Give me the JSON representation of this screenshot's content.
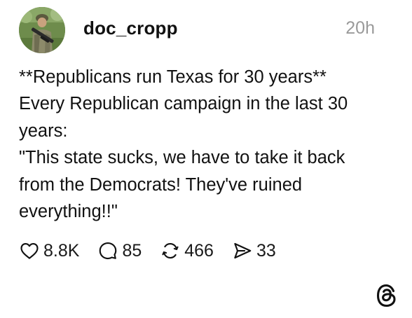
{
  "post": {
    "author": {
      "username": "doc_cropp",
      "avatar_icon": "soldier-avatar"
    },
    "timestamp": "20h",
    "text_lines": [
      "**Republicans run Texas for 30 years**",
      "Every Republican campaign in the last 30",
      "years:",
      "\"This state sucks, we have to take it back",
      "from the Democrats! They've ruined",
      "everything!!\""
    ],
    "actions": {
      "like": {
        "icon": "heart-icon",
        "count": "8.8K"
      },
      "reply": {
        "icon": "comment-icon",
        "count": "85"
      },
      "repost": {
        "icon": "repost-icon",
        "count": "466"
      },
      "share": {
        "icon": "send-icon",
        "count": "33"
      }
    }
  },
  "branding": {
    "logo_icon": "threads-logo"
  },
  "colors": {
    "text": "#111111",
    "muted": "#9a9a9a",
    "background": "#ffffff"
  }
}
